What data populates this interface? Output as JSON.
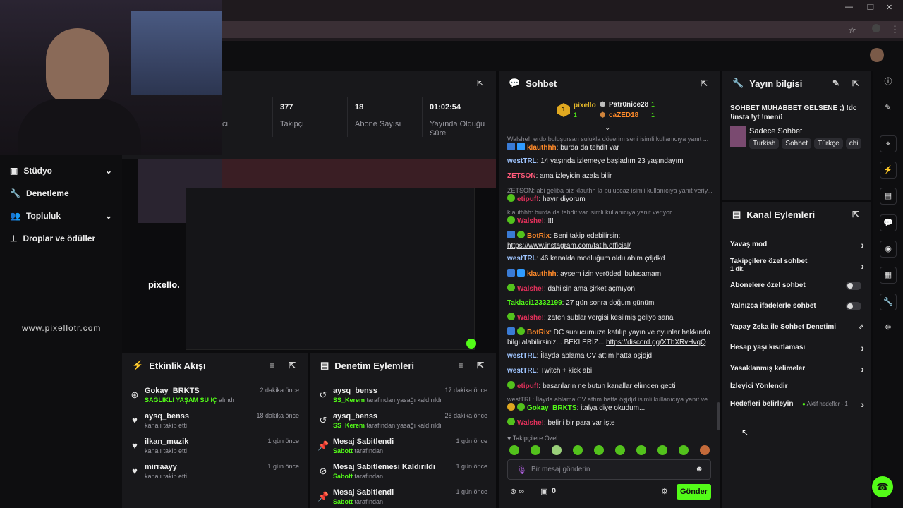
{
  "watermark": "www.pixellotr.com",
  "channel_logo_text": "pixello.",
  "sidebar": {
    "items": [
      {
        "label": "Stüdyo",
        "icon": "studio-icon",
        "expandable": true
      },
      {
        "label": "Denetleme",
        "icon": "wrench-icon",
        "expandable": false
      },
      {
        "label": "Topluluk",
        "icon": "community-icon",
        "expandable": true
      },
      {
        "label": "Droplar ve ödüller",
        "icon": "drops-icon",
        "expandable": false
      }
    ]
  },
  "stats": {
    "partial_label": "ci",
    "cells": [
      {
        "value": "377",
        "label": "Takipçi"
      },
      {
        "value": "18",
        "label": "Abone Sayısı"
      },
      {
        "value": "01:02:54",
        "label": "Yayında Olduğu Süre"
      }
    ]
  },
  "activity_feed": {
    "title": "Etkinlik Akışı",
    "items": [
      {
        "name": "Gokay_BRKTS",
        "time": "2 dakika önce",
        "sub_highlight": "SAĞLIKLI YAŞAM SU İÇ",
        "sub": "alındı",
        "icon": "redeem-icon"
      },
      {
        "name": "aysq_benss",
        "time": "18 dakika önce",
        "sub_highlight": "",
        "sub": "kanalı takip etti",
        "icon": "heart-icon"
      },
      {
        "name": "ilkan_muzik",
        "time": "1 gün önce",
        "sub_highlight": "",
        "sub": "kanalı takip etti",
        "icon": "heart-icon"
      },
      {
        "name": "mirraayy",
        "time": "1 gün önce",
        "sub_highlight": "",
        "sub": "kanalı takip etti",
        "icon": "heart-icon"
      }
    ]
  },
  "mod_actions": {
    "title": "Denetim Eylemleri",
    "items": [
      {
        "name": "aysq_benss",
        "time": "17 dakika önce",
        "sub_highlight": "SS_Kerem",
        "sub": "tarafından yasağı kaldırıldı",
        "icon": "unban-icon"
      },
      {
        "name": "aysq_benss",
        "time": "28 dakika önce",
        "sub_highlight": "SS_Kerem",
        "sub": "tarafından yasağı kaldırıldı",
        "icon": "unban-icon"
      },
      {
        "name": "Mesaj Sabitlendi",
        "time": "1 gün önce",
        "sub_highlight": "Sabott",
        "sub": "tarafından",
        "icon": "pin-icon"
      },
      {
        "name": "Mesaj Sabitlemesi Kaldırıldı",
        "time": "1 gün önce",
        "sub_highlight": "Sabott",
        "sub": "tarafından",
        "icon": "unpin-icon"
      },
      {
        "name": "Mesaj Sabitlendi",
        "time": "1 gün önce",
        "sub_highlight": "Sabott",
        "sub": "tarafından",
        "icon": "pin-icon"
      }
    ]
  },
  "chat": {
    "title": "Sohbet",
    "leaderboard": {
      "first": {
        "name": "pixello",
        "count": "1"
      },
      "second": {
        "name": "Patr0nice28",
        "count": "1"
      },
      "third": {
        "name": "caZED18",
        "count": "1"
      }
    },
    "messages": [
      {
        "type": "reply",
        "text": "Walshe!: erdo buluşursan sulukla döverim seni isimli kullanıcıya yanıt ..."
      },
      {
        "type": "msg",
        "user": "klauthhh",
        "color": "#ff8a2a",
        "text": "burda da tehdit var",
        "badges": true
      },
      {
        "type": "msg",
        "user": "westTRL",
        "color": "#9fc5ff",
        "text": "14 yaşında izlemeye başladım 23 yaşındayım"
      },
      {
        "type": "msg",
        "user": "ZETSON",
        "color": "#ff5a7a",
        "text": "ama izleyicin azala bilir"
      },
      {
        "type": "reply",
        "text": "ZETSON: abi geliba biz klauthh la buluscaz isimli kullanıcıya yanıt veriy..."
      },
      {
        "type": "msg",
        "user": "etipuf!",
        "color": "#e0305a",
        "text": "hayır diyorum",
        "badges": true
      },
      {
        "type": "reply",
        "text": "klauthhh: burda da tehdit var isimli kullanıcıya yanıt veriyor"
      },
      {
        "type": "msg",
        "user": "Walshe!",
        "color": "#e0305a",
        "text": "!!!",
        "badges": true
      },
      {
        "type": "msg",
        "user": "BotRix",
        "color": "#ff8a2a",
        "text": "Beni takip edebilirsin;",
        "link": "https://www.instagram.com/fatih.official/",
        "badges": true
      },
      {
        "type": "msg",
        "user": "westTRL",
        "color": "#9fc5ff",
        "text": "46 kanalda modluğum oldu abim çdjdkd"
      },
      {
        "type": "msg",
        "user": "klauthhh",
        "color": "#ff8a2a",
        "text": "aysem izin verödedi bulusamam",
        "badges": true
      },
      {
        "type": "msg",
        "user": "Walshe!",
        "color": "#e0305a",
        "text": "dahilsin ama şirket açmıyon",
        "badges": true
      },
      {
        "type": "msg",
        "user": "Taklaci12332199",
        "color": "#53fc18",
        "text": "27 gün sonra doğum günüm"
      },
      {
        "type": "msg",
        "user": "Walshe!",
        "color": "#e0305a",
        "text": "zaten sublar vergisi kesilmiş geliyo sana",
        "badges": true
      },
      {
        "type": "msg",
        "user": "BotRix",
        "color": "#ff8a2a",
        "text": "DC sunucumuza katılıp yayın ve oyunlar hakkında bilgi alabilirsiniz... BEKLERİZ...",
        "link": "https://discord.gg/XTbXRvHvqQ",
        "badges": true
      },
      {
        "type": "msg",
        "user": "westTRL",
        "color": "#9fc5ff",
        "text": "İlayda ablama CV attım hatta öşjdjd"
      },
      {
        "type": "msg",
        "user": "westTRL",
        "color": "#9fc5ff",
        "text": "Twitch + kick abi"
      },
      {
        "type": "msg",
        "user": "etipuf!",
        "color": "#e0305a",
        "text": "basarıların ne butun kanallar elimden gecti",
        "badges": true
      },
      {
        "type": "reply",
        "text": "westTRL: İlayda ablama CV attım hatta öşjdjd isimli kullanıcıya yanıt ve..."
      },
      {
        "type": "msg",
        "user": "Gokay_BRKTS",
        "color": "#53fc18",
        "text": "italya diye okudum...",
        "badges": true
      },
      {
        "type": "msg",
        "user": "Walshe!",
        "color": "#e0305a",
        "text": "belirli bir para var işte",
        "badges": true
      }
    ],
    "emote_label": "Takipçilere Özel",
    "input_placeholder": "Bir mesaj gönderin",
    "points_value": "0",
    "send_label": "Gönder"
  },
  "stream_info": {
    "title": "Yayın bilgisi",
    "stream_title": "SOHBET MUHABBET GELSENE ;) !dc !insta !yt !menü",
    "category": "Sadece Sohbet",
    "tags": [
      "Turkish",
      "Sohbet",
      "Türkçe",
      "chi"
    ]
  },
  "channel_actions": {
    "title": "Kanal Eylemleri",
    "items": [
      {
        "label": "Yavaş mod",
        "control": "arrow",
        "sub": ""
      },
      {
        "label": "Takipçilere özel sohbet",
        "control": "arrow",
        "sub": "1 dk."
      },
      {
        "label": "Abonelere özel sohbet",
        "control": "toggle",
        "sub": ""
      },
      {
        "label": "Yalnızca ifadelerle sohbet",
        "control": "toggle",
        "sub": ""
      },
      {
        "label": "Yapay Zeka ile Sohbet Denetimi",
        "control": "external",
        "sub": ""
      },
      {
        "label": "Hesap yaşı kısıtlaması",
        "control": "arrow",
        "sub": ""
      },
      {
        "label": "Yasaklanmış kelimeler",
        "control": "arrow",
        "sub": ""
      },
      {
        "label": "İzleyici Yönlendir",
        "control": "none",
        "sub": ""
      },
      {
        "label": "Hedefleri belirleyin",
        "control": "arrow",
        "sub": "Aktif hedefler - 1"
      }
    ]
  },
  "colors": {
    "accent": "#53fc18",
    "panel": "#18181b",
    "bg": "#0b0b0d"
  }
}
